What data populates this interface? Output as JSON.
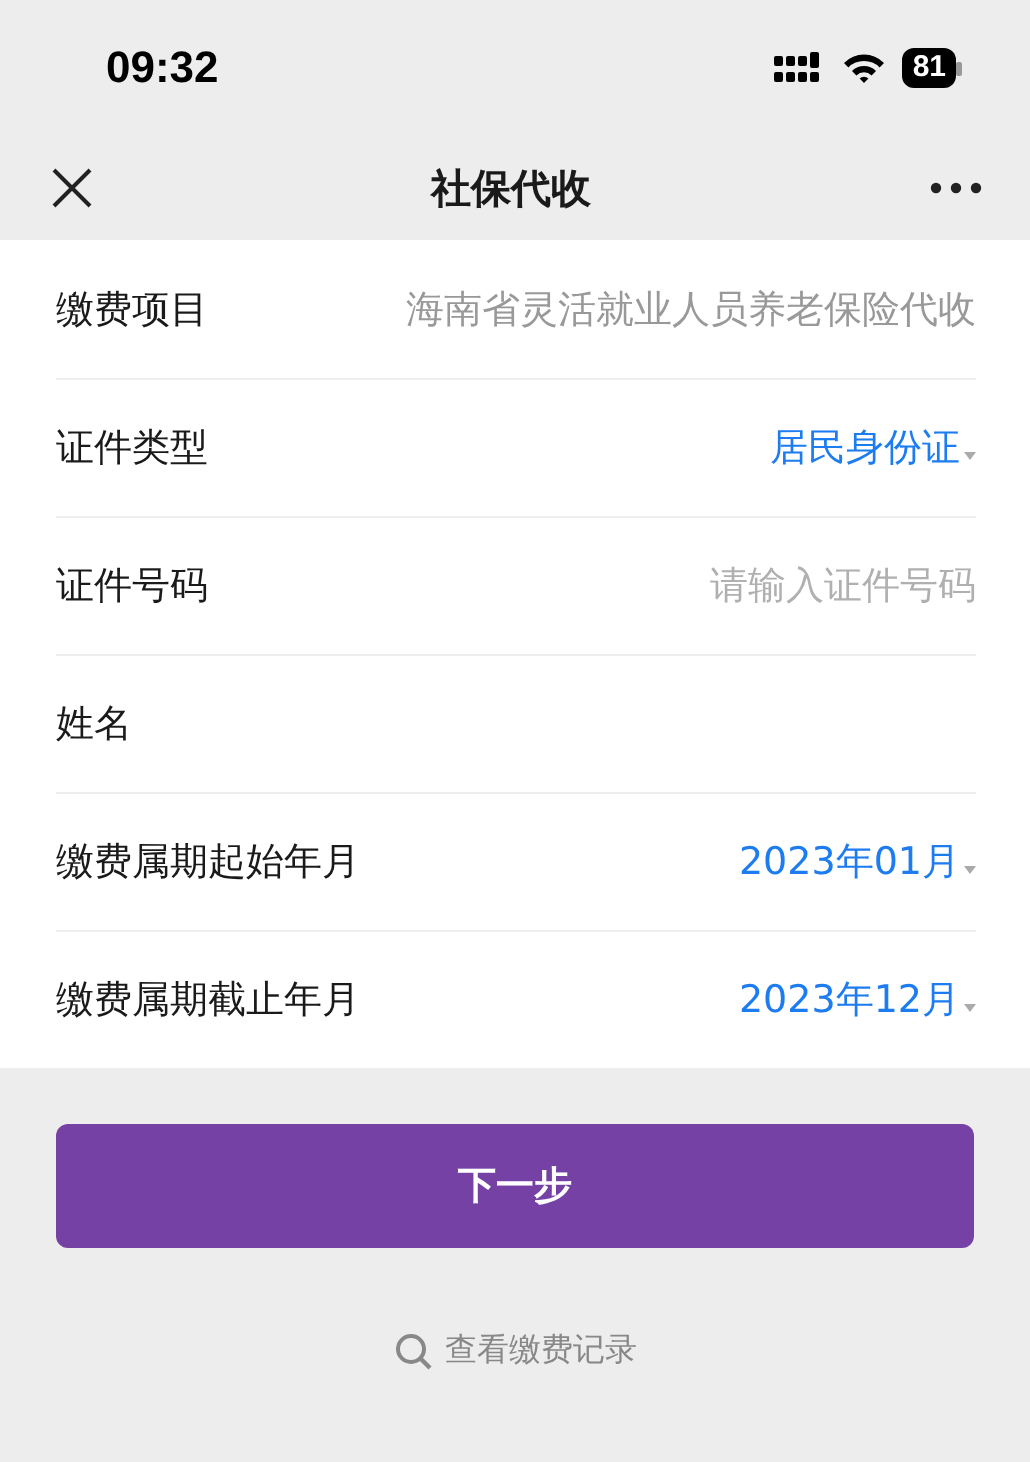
{
  "status_bar": {
    "time": "09:32",
    "battery": "81"
  },
  "nav_bar": {
    "title": "社保代收"
  },
  "form": {
    "rows": [
      {
        "kind": "static",
        "label": "缴费项目",
        "value": "海南省灵活就业人员养老保险代收"
      },
      {
        "kind": "select",
        "label": "证件类型",
        "value": "居民身份证"
      },
      {
        "kind": "input",
        "label": "证件号码",
        "placeholder": "请输入证件号码"
      },
      {
        "kind": "input",
        "label": "姓名"
      },
      {
        "kind": "select",
        "label": "缴费属期起始年月",
        "value": "2023年01月"
      },
      {
        "kind": "select",
        "label": "缴费属期截止年月",
        "value": "2023年12月"
      }
    ]
  },
  "next_button": "下一步",
  "records_link": "查看缴费记录"
}
